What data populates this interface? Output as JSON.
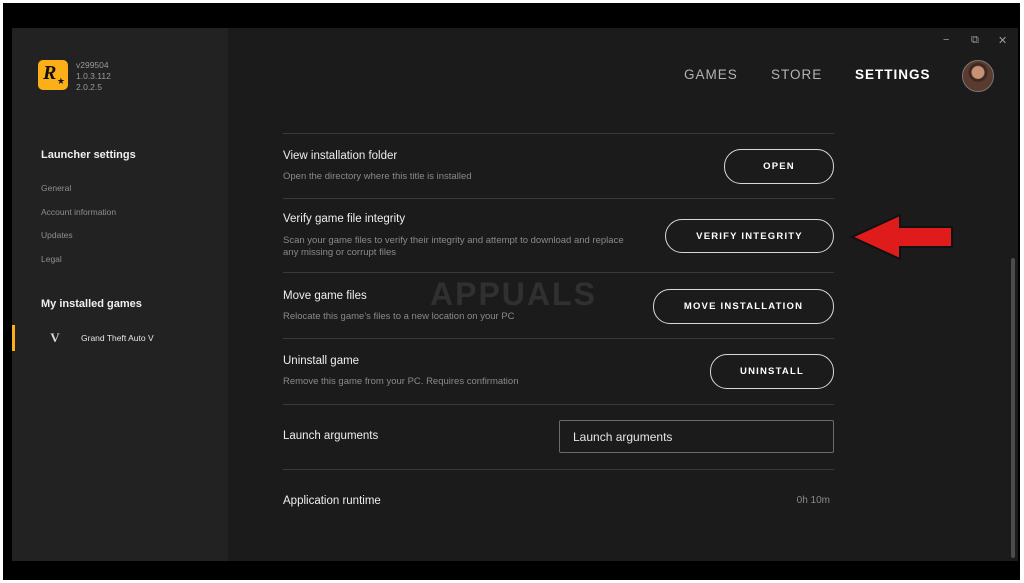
{
  "app": {
    "versions": [
      "v299504",
      "1.0.3.112",
      "2.0.2.5"
    ],
    "logo_letter": "R",
    "accent": "#fcaf17"
  },
  "sidebar": {
    "launcher_heading": "Launcher settings",
    "items": [
      {
        "label": "General"
      },
      {
        "label": "Account information"
      },
      {
        "label": "Updates"
      },
      {
        "label": "Legal"
      }
    ],
    "games_heading": "My installed games",
    "games": [
      {
        "label": "Grand Theft Auto V",
        "icon": "V"
      }
    ]
  },
  "window": {
    "minimize": "−",
    "restore": "⧉",
    "close": "✕"
  },
  "nav": {
    "games": "GAMES",
    "store": "STORE",
    "settings": "SETTINGS",
    "active": "settings"
  },
  "settings": {
    "view_folder": {
      "title": "View installation folder",
      "desc": "Open the directory where this title is installed",
      "button": "OPEN"
    },
    "verify": {
      "title": "Verify game file integrity",
      "desc": "Scan your game files to verify their integrity and attempt to download and replace any missing or corrupt files",
      "button": "VERIFY INTEGRITY"
    },
    "move": {
      "title": "Move game files",
      "desc": "Relocate this game's files to a new location on your PC",
      "button": "MOVE INSTALLATION"
    },
    "uninstall": {
      "title": "Uninstall game",
      "desc": "Remove this game from your PC. Requires confirmation",
      "button": "UNINSTALL"
    },
    "launch_args": {
      "title": "Launch arguments",
      "placeholder": "Launch arguments"
    },
    "runtime": {
      "title": "Application runtime",
      "value": "0h 10m"
    }
  },
  "watermark": "APPUALS",
  "annotation_color": "#e01b1b"
}
